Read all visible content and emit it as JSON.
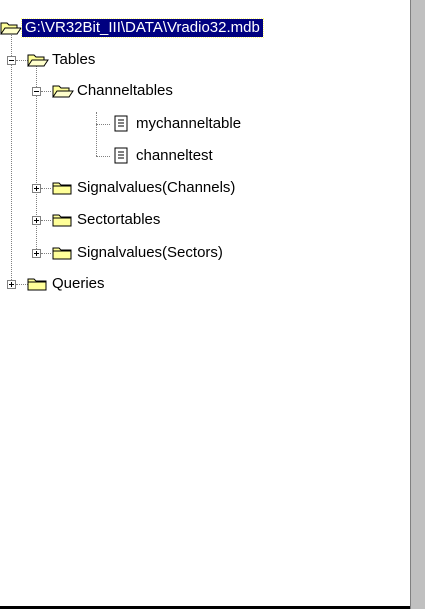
{
  "tree": {
    "root": {
      "label": "G:\\VR32Bit_III\\DATA\\Vradio32.mdb",
      "icon": "open-folder-icon"
    },
    "tables": {
      "label": "Tables",
      "icon": "open-folder-icon"
    },
    "channeltables": {
      "label": "Channeltables",
      "icon": "open-folder-icon"
    },
    "mychanneltable": {
      "label": "mychanneltable",
      "icon": "document-icon"
    },
    "channeltest": {
      "label": "channeltest",
      "icon": "document-icon"
    },
    "signalvalues_channels": {
      "label": "Signalvalues(Channels)",
      "icon": "closed-folder-icon"
    },
    "sectortables": {
      "label": "Sectortables",
      "icon": "closed-folder-icon"
    },
    "signalvalues_sectors": {
      "label": "Signalvalues(Sectors)",
      "icon": "closed-folder-icon"
    },
    "queries": {
      "label": "Queries",
      "icon": "closed-folder-icon"
    }
  },
  "colors": {
    "selection": "#000080",
    "folder": "#ffff99",
    "line": "#808080"
  }
}
